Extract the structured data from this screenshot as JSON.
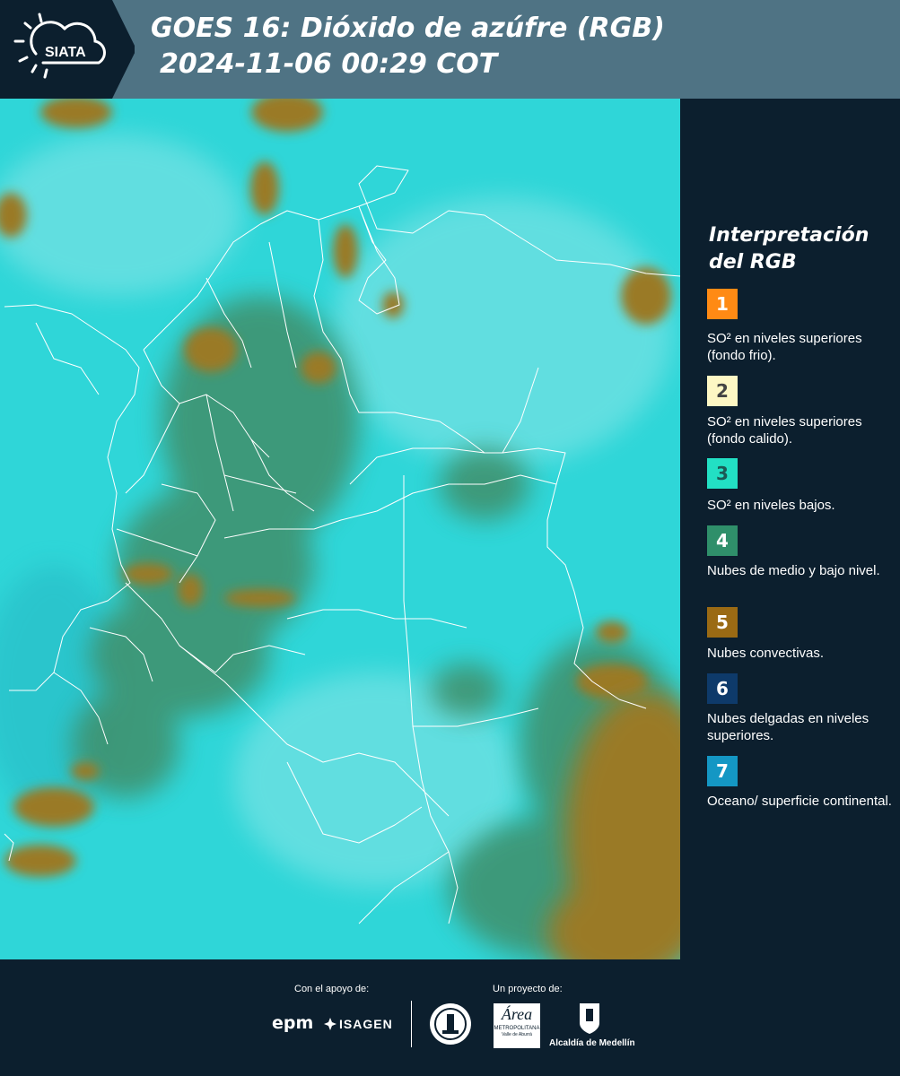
{
  "header": {
    "logo_text": "SIATA",
    "title_line1": "GOES 16: Dióxido de azúfre (RGB)",
    "title_line2": "2024-11-06 00:29 COT"
  },
  "map": {
    "background_color": "#2fd6d8",
    "convective_color": "#9a7a28",
    "lowcloud_color": "#3f8f6a",
    "border_color": "#ffffff"
  },
  "legend": {
    "title": "Interpretación del RGB",
    "items": [
      {
        "number": "1",
        "color": "#ff8a14",
        "text_color": "#ffffff",
        "label": "SO² en niveles superiores (fondo frio)."
      },
      {
        "number": "2",
        "color": "#fdf7c4",
        "text_color": "#444444",
        "label": "SO² en niveles superiores (fondo calido)."
      },
      {
        "number": "3",
        "color": "#22e0c4",
        "text_color": "#1c5a55",
        "label": "SO² en niveles bajos."
      },
      {
        "number": "4",
        "color": "#2f8f6a",
        "text_color": "#ffffff",
        "label": "Nubes de medio y bajo nivel."
      },
      {
        "number": "5",
        "color": "#9a6a14",
        "text_color": "#ffffff",
        "label": "Nubes convectivas."
      },
      {
        "number": "6",
        "color": "#0e3a6a",
        "text_color": "#ffffff",
        "label": "Nubes delgadas en niveles superiores."
      },
      {
        "number": "7",
        "color": "#1497c4",
        "text_color": "#ffffff",
        "label": "Oceano/ superficie continental."
      }
    ]
  },
  "footer": {
    "support_label": "Con el apoyo de:",
    "project_label": "Un proyecto de:",
    "epm": "epm",
    "isagen": "ISAGEN",
    "area_top": "Área",
    "area_bottom": "METROPOLITANA",
    "area_sub": "Valle de Aburrá",
    "alcaldia": "Alcaldía de Medellín"
  }
}
